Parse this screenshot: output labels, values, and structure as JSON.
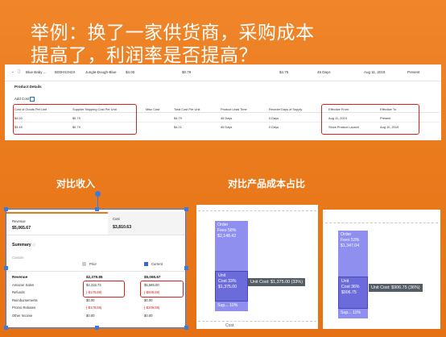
{
  "title": "举例：换了一家供货商，采购成本提高了，利润率是否提高？",
  "product_row": {
    "name": "Blue Baby ...",
    "asin": "B00HX2H2X",
    "sku": "Jungle-Dough-Blue",
    "price": "$4.00",
    "v1": "$0.79",
    "v2": "$4.75",
    "lead": "45 Days",
    "date": "Aug 11, 2019",
    "status": "Present"
  },
  "product_details_label": "Product Details",
  "add_cost_label": "Add Cost",
  "cost_table": {
    "headers": [
      "Cost of Goods Per Unit",
      "Supplier Shipping Cost Per Unit",
      "Misc Cost",
      "Total Cost Per Unit",
      "Product Lead Time",
      "Reorder Days of Supply",
      "Effective From",
      "Effective To"
    ],
    "rows": [
      [
        "$4.00",
        "$0.79",
        "",
        "$4.79",
        "45 Days",
        "0 Days",
        "Aug 11, 2019",
        "Present"
      ],
      [
        "$3.45",
        "$0.79",
        "",
        "$4.21",
        "45 Days",
        "0 Days",
        "Since Product Launch",
        "Aug 10, 2019"
      ]
    ]
  },
  "section_left": "对比收入",
  "section_right": "对比产品成本占比",
  "summary": {
    "revenue_label": "Revenue",
    "revenue_value": "$5,065.67",
    "cost_label": "Cost",
    "cost_value": "$3,810.63",
    "heading": "Summary",
    "custom_label": "Custom",
    "prior_label": "Prior",
    "current_label": "Current",
    "rows": [
      {
        "label": "Revenue",
        "prior": "$2,379.85",
        "current": "$5,065.67"
      },
      {
        "label": "Amazon Sales",
        "prior": "$4,316.73",
        "current": "$5,585.00"
      },
      {
        "label": "Refunds",
        "prior": "(-$179.88)",
        "current": "(-$509.88)"
      },
      {
        "label": "Reimbursements",
        "prior": "$0.00",
        "current": "$0.00"
      },
      {
        "label": "Promo Rebates",
        "prior": "(-$179.88)",
        "current": "(-$209.88)"
      },
      {
        "label": "Other Income",
        "prior": "$0.00",
        "current": "$0.00"
      }
    ]
  },
  "chart_data": [
    {
      "type": "bar",
      "stacked": true,
      "segments": [
        {
          "name": "Order Fees",
          "percent": 58,
          "value": "$2,148.42"
        },
        {
          "name": "Unit Cost",
          "percent": 33,
          "value": "$1,375.00"
        },
        {
          "name": "Sup...",
          "percent": 10,
          "value": ""
        }
      ],
      "tooltip": "Unit Cost: $1,375.00 (33%)",
      "xlabel": "Cost"
    },
    {
      "type": "bar",
      "stacked": true,
      "segments": [
        {
          "name": "Order Fees",
          "percent": 53,
          "value": "$1,347.04"
        },
        {
          "name": "Unit Cost",
          "percent": 36,
          "value": "$906.75"
        },
        {
          "name": "Sup...",
          "percent": 11,
          "value": ""
        }
      ],
      "tooltip": "Unit Cost: $906.75 (36%)",
      "xlabel": ""
    }
  ],
  "colors": {
    "bar": "#8f8ff0",
    "bar_dark": "#6b6bdc",
    "accent": "#e0201c",
    "selection": "#3a7be0"
  }
}
